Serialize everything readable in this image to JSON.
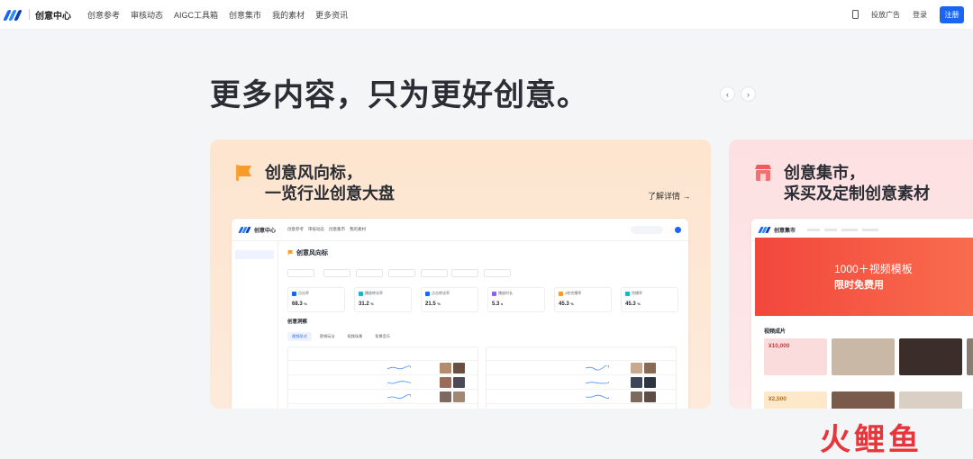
{
  "nav": {
    "brand": "创意中心",
    "menu": [
      "创意参考",
      "审核动态",
      "AIGC工具箱",
      "创意集市",
      "我的素材",
      "更多资讯"
    ],
    "advertise": "投放广告",
    "login": "登录",
    "register": "注册"
  },
  "hero": {
    "title": "更多内容，只为更好创意。"
  },
  "colors": {
    "brand_blue": "#1b65f5",
    "orange": "#f69a2a",
    "red": "#f2473c"
  },
  "card1": {
    "title_line1": "创意风向标，",
    "title_line2": "一览行业创意大盘",
    "detail": "了解详情 →",
    "screenshot": {
      "brand": "创意中心",
      "title": "创意风向标",
      "stats": [
        {
          "label": "点击率",
          "value": "68.3",
          "unit": "%",
          "color": "#1b65f5"
        },
        {
          "label": "播放转化率",
          "value": "31.2",
          "unit": "%",
          "color": "#19b5c8"
        },
        {
          "label": "点击转化率",
          "value": "21.5",
          "unit": "%",
          "color": "#1b65f5"
        },
        {
          "label": "播放时长",
          "value": "5.3",
          "unit": "s",
          "color": "#8a63f2"
        },
        {
          "label": "3秒完播率",
          "value": "45.3",
          "unit": "%",
          "color": "#f69a2a"
        },
        {
          "label": "完播率",
          "value": "45.3",
          "unit": "%",
          "color": "#19b5c8"
        }
      ],
      "section": "创意洞察",
      "tabs": [
        "视频形式",
        "营销玩法",
        "视频场景",
        "背景音乐"
      ]
    }
  },
  "card2": {
    "title_line1": "创意集市，",
    "title_line2": "采买及定制创意素材",
    "screenshot": {
      "brand": "创意集市",
      "banner_line1": "1000＋视频模板",
      "banner_line2": "限时免费用",
      "section": "视频成片",
      "price1": "¥10,000",
      "price2": "¥2,500"
    }
  },
  "watermark": {
    "text": "火鲤鱼"
  }
}
